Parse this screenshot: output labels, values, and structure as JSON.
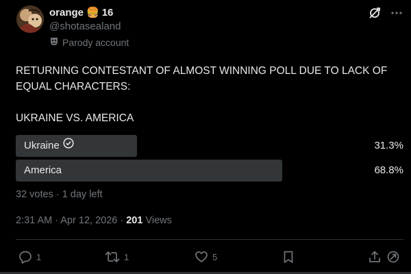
{
  "author": {
    "name": "orange",
    "name_emoji": "🍔",
    "name_suffix": "16",
    "handle": "@shotasealand",
    "parody_label": "Parody account"
  },
  "post": {
    "text": "RETURNING CONTESTANT OF ALMOST WINNING POLL DUE TO LACK OF EQUAL CHARACTERS:\n\nUKRAINE VS. AMERICA"
  },
  "poll": {
    "options": [
      {
        "label": "Ukraine",
        "percent_text": "31.3%",
        "share": 0.313,
        "user_choice": true
      },
      {
        "label": "America",
        "percent_text": "68.8%",
        "share": 0.688,
        "user_choice": false
      }
    ],
    "meta": "32 votes · 1 day left"
  },
  "timestamp": {
    "time": "2:31 AM · Apr 12, 2026 · ",
    "views_count": "201",
    "views_label": " Views"
  },
  "actions": {
    "replies": "1",
    "reposts": "1",
    "likes": "5"
  },
  "colors": {
    "background": "#000000",
    "text_primary": "#e7e9ea",
    "text_secondary": "#71767b",
    "poll_bar": "#333639",
    "divider": "#2f3336"
  }
}
